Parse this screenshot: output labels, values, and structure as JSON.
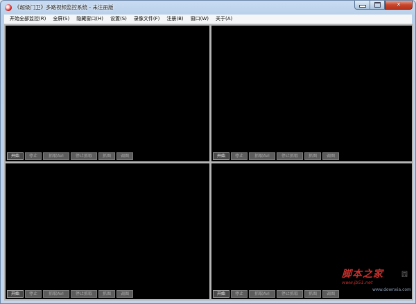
{
  "window": {
    "title": "《超级门卫》多路视频监控系统 - 未注册版",
    "controls": {
      "close": "✕"
    }
  },
  "menu": [
    "开始全部监控(R)",
    "全屏(S)",
    "隐藏窗口(H)",
    "设置(S)",
    "录像文件(F)",
    "注册(B)",
    "窗口(W)",
    "关于(A)"
  ],
  "pane_buttons": [
    "开始",
    "停止",
    "抓取AVI",
    "停止抓取",
    "抓图",
    "调图"
  ],
  "watermark": {
    "main": "脚本之家",
    "side": "园",
    "line1": "www.jb51.net",
    "line2": "www.downxia.com"
  }
}
